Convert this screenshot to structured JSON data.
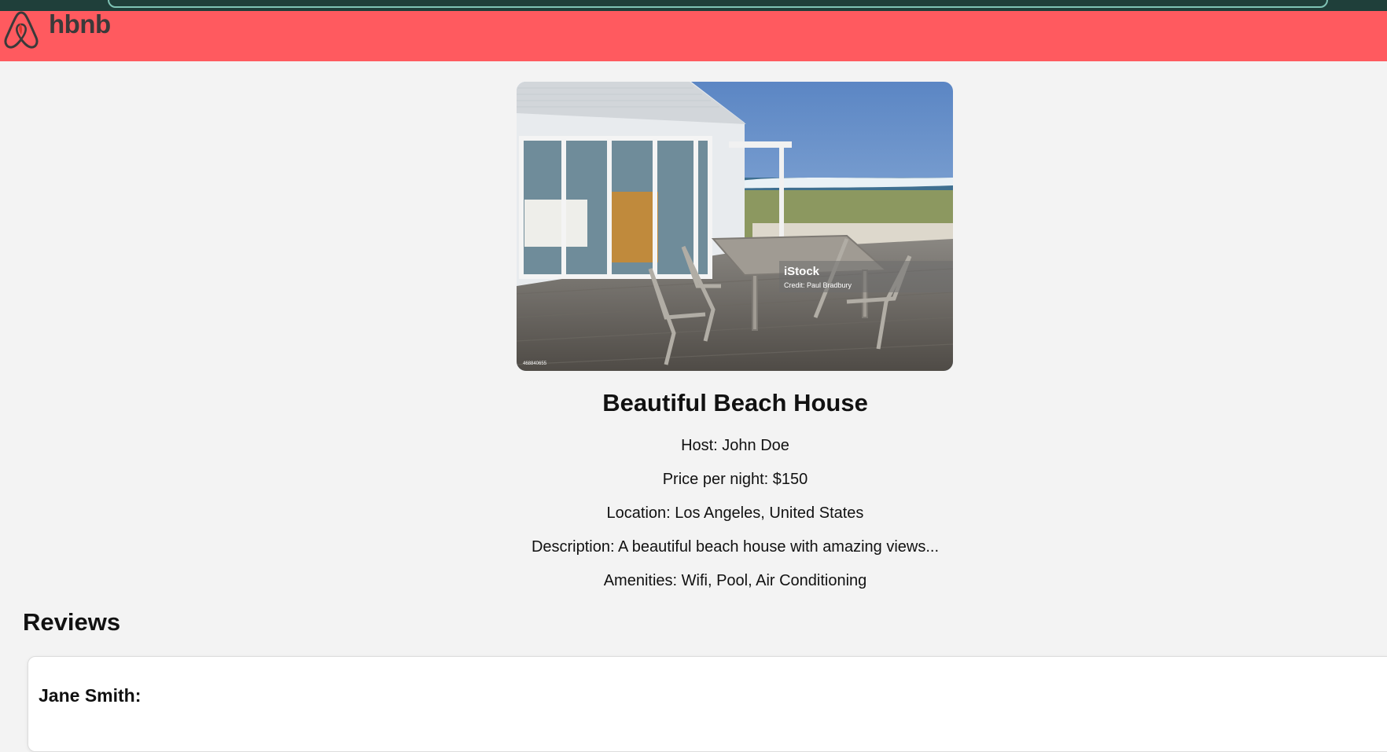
{
  "header": {
    "logo_text": "hbnb",
    "brand_color": "#ff5a5f"
  },
  "place": {
    "image_watermark": "iStock",
    "image_credit": "Credit: Paul Bradbury",
    "image_id": "468840655",
    "title": "Beautiful Beach House",
    "host": "Host: John Doe",
    "price": "Price per night: $150",
    "location": "Location: Los Angeles, United States",
    "description": "Description: A beautiful beach house with amazing views...",
    "amenities": "Amenities: Wifi, Pool, Air Conditioning"
  },
  "reviews": {
    "heading": "Reviews",
    "items": [
      {
        "reviewer": "Jane Smith:"
      }
    ]
  }
}
